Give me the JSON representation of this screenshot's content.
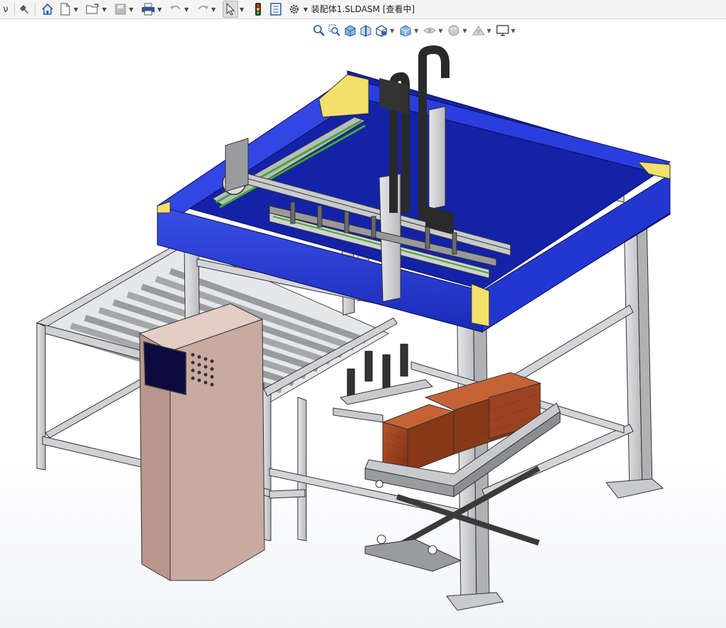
{
  "window": {
    "title": "装配体1.SLDASM [查看中]",
    "left_glyph": "ν"
  },
  "toolbar": {
    "items": [
      "pin-icon",
      "home-icon",
      "new-file-icon",
      "open-file-icon",
      "save-icon",
      "print-icon",
      "undo-icon",
      "redo-icon",
      "select-icon",
      "traffic-light-icon",
      "file-properties-icon",
      "options-gear-icon"
    ]
  },
  "headsup": {
    "items": [
      "zoom-to-fit-icon",
      "zoom-area-icon",
      "previous-view-icon",
      "section-view-icon",
      "view-orientation-icon",
      "display-style-icon",
      "hide-show-icon",
      "edit-appearance-icon",
      "apply-scene-icon",
      "view-settings-icon"
    ]
  },
  "colors": {
    "frame_blue": "#1d2fd0",
    "corner_yellow": "#f2e06a",
    "steel": "#d2d3d6",
    "cabinet": "#c8aaa0",
    "bricks": "#9a4020"
  }
}
